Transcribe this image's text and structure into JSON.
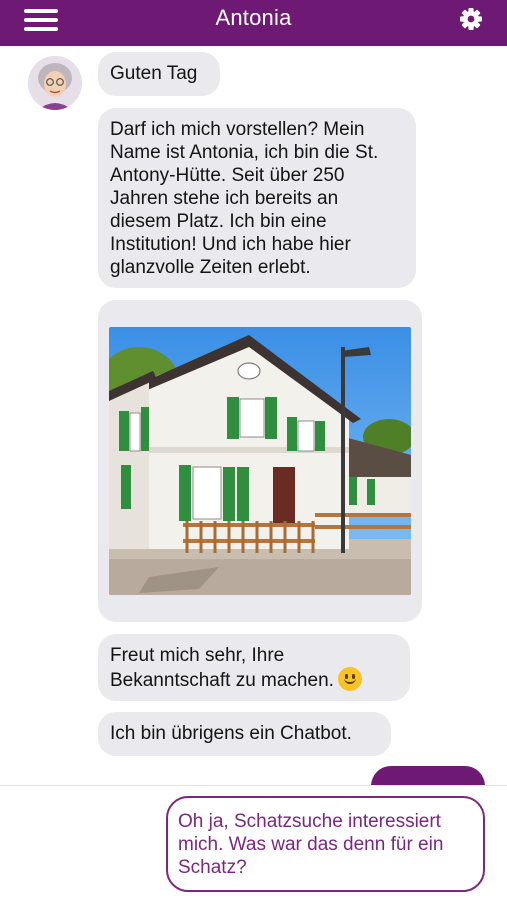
{
  "header": {
    "title": "Antonia",
    "menu_icon": "menu-icon",
    "settings_icon": "gear-icon",
    "background": "#6e1a74"
  },
  "messages": [
    {
      "from": "bot",
      "text": "Guten Tag"
    },
    {
      "from": "bot",
      "text": "Darf ich mich vorstellen? Mein Name ist Antonia, ich bin die St. Antony-Hütte. Seit über 250 Jahren stehe ich bereits an diesem Platz. Ich bin eine Institution! Und ich habe hier glanzvolle Zeiten erlebt."
    },
    {
      "from": "bot",
      "type": "image",
      "image": "photo of the St. Antony-Hütte building"
    },
    {
      "from": "bot",
      "text": "Freut mich sehr, Ihre Bekanntschaft zu machen.",
      "emoji": "smiley-emoji"
    },
    {
      "from": "bot",
      "text": "Ich bin übrigens ein Chatbot."
    }
  ],
  "reply_option": {
    "text": "Oh ja, Schatzsuche interessiert mich. Was war das denn für ein Schatz?",
    "accent": "#7b2680"
  }
}
